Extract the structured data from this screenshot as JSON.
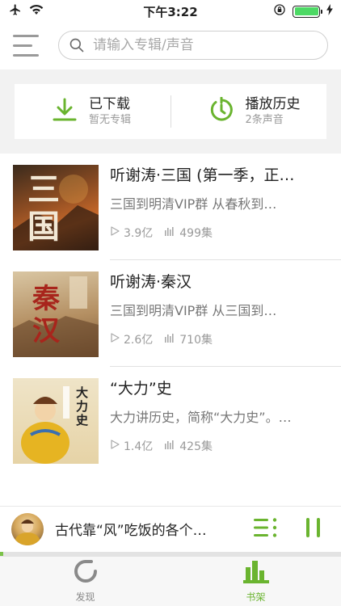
{
  "status_bar": {
    "time": "下午3:22"
  },
  "search": {
    "placeholder": "请输入专辑/声音"
  },
  "quick_actions": [
    {
      "title": "已下载",
      "subtitle": "暂无专辑",
      "icon": "download-icon"
    },
    {
      "title": "播放历史",
      "subtitle": "2条声音",
      "icon": "history-icon"
    }
  ],
  "albums": [
    {
      "title": "听谢涛·三国 (第一季，正…",
      "description": "三国到明清VIP群  从春秋到…",
      "plays": "3.9亿",
      "episodes": "499集",
      "cover_text": "三国"
    },
    {
      "title": "听谢涛·秦汉",
      "description": "三国到明清VIP群   从三国到…",
      "plays": "2.6亿",
      "episodes": "710集",
      "cover_text": "秦汉"
    },
    {
      "title": "“大力”史",
      "description": "大力讲历史，简称“大力史”。…",
      "plays": "1.4亿",
      "episodes": "425集",
      "cover_text": "大力史"
    }
  ],
  "player": {
    "title": "古代靠“风”吃饭的各个…",
    "progress": 0.01
  },
  "tabs": [
    {
      "label": "发现",
      "icon": "refresh-icon",
      "active": false
    },
    {
      "label": "书架",
      "icon": "bookshelf-icon",
      "active": true
    }
  ],
  "colors": {
    "accent": "#6ab42f",
    "accent_light": "#7cc24a"
  }
}
